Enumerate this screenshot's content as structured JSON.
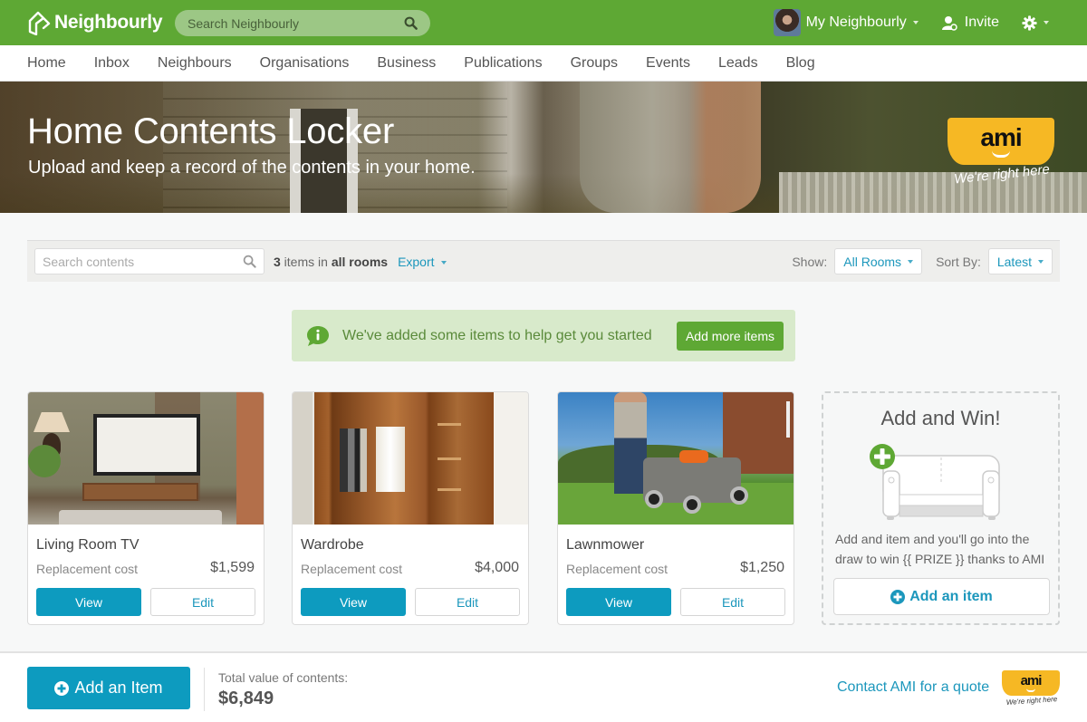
{
  "topbar": {
    "brand": "Neighbourly",
    "search_placeholder": "Search Neighbourly",
    "my_neighbourly": "My Neighbourly",
    "invite": "Invite",
    "icons": {
      "logo": "house-outline-icon",
      "search": "search-icon",
      "invite": "user-plus-icon",
      "settings": "gear-icon"
    }
  },
  "nav": {
    "items": [
      "Home",
      "Inbox",
      "Neighbours",
      "Organisations",
      "Business",
      "Publications",
      "Groups",
      "Events",
      "Leads",
      "Blog"
    ]
  },
  "hero": {
    "title": "Home Contents Locker",
    "subtitle": "Upload and keep a record of the contents in your home.",
    "sponsor": {
      "name": "ami",
      "tagline": "We're right here"
    }
  },
  "toolbar": {
    "search_placeholder": "Search contents",
    "count": "3",
    "count_mid": " items in ",
    "count_scope": "all rooms",
    "export_label": "Export",
    "show_label": "Show:",
    "show_value": "All Rooms",
    "sort_label": "Sort By:",
    "sort_value": "Latest"
  },
  "notice": {
    "message": "We've added some items to help get you started",
    "button": "Add more items"
  },
  "items": [
    {
      "name": "Living Room TV",
      "cost_label": "Replacement cost",
      "price": "$1,599",
      "view": "View",
      "edit": "Edit"
    },
    {
      "name": "Wardrobe",
      "cost_label": "Replacement cost",
      "price": "$4,000",
      "view": "View",
      "edit": "Edit"
    },
    {
      "name": "Lawnmower",
      "cost_label": "Replacement cost",
      "price": "$1,250",
      "view": "View",
      "edit": "Edit"
    }
  ],
  "promo": {
    "title": "Add and Win!",
    "text": "Add and item and you'll go into the draw to win {{ PRIZE }} thanks to AMI",
    "button": "Add an item"
  },
  "footer": {
    "add_button": "Add an Item",
    "total_label": "Total value of contents:",
    "total_value": "$6,849",
    "contact_link": "Contact AMI for a quote",
    "sponsor": {
      "name": "ami",
      "tagline": "We're right here"
    }
  },
  "colors": {
    "brand_green": "#5ea834",
    "accent_blue": "#0d9bbf",
    "link_blue": "#1c97bc",
    "notice_bg": "#d8eacb",
    "ami_yellow": "#f6b824"
  }
}
